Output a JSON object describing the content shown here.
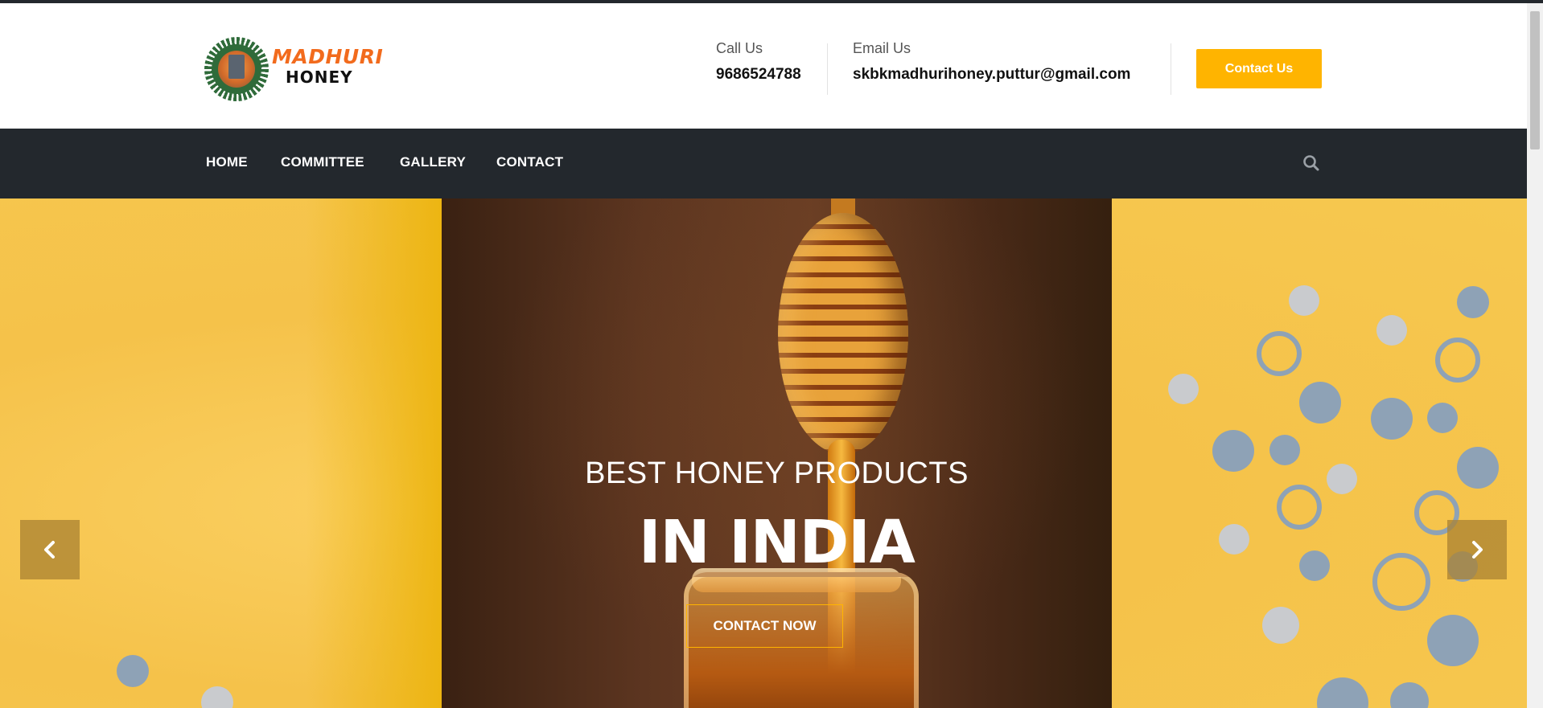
{
  "brand": {
    "logo_word1": "MADHURI",
    "logo_word2": "HONEY"
  },
  "contact": {
    "call_label": "Call Us",
    "call_value": "9686524788",
    "email_label": "Email Us",
    "email_value": "skbkmadhurihoney.puttur@gmail.com",
    "button_label": "Contact Us"
  },
  "nav": {
    "items": [
      {
        "label": "HOME"
      },
      {
        "label": "COMMITTEE"
      },
      {
        "label": "GALLERY"
      },
      {
        "label": "CONTACT"
      }
    ],
    "search_icon": "search-icon"
  },
  "hero": {
    "subtitle": "BEST HONEY PRODUCTS",
    "title": "IN INDIA",
    "button_label": "CONTACT NOW",
    "prev_icon": "chevron-left-icon",
    "next_icon": "chevron-right-icon"
  },
  "colors": {
    "accent": "#ffb400",
    "nav_bg": "#23282d",
    "hero_bg": "#f6c84f",
    "dot_blue": "#8ea2b6",
    "dot_grey": "#c9cbce"
  }
}
